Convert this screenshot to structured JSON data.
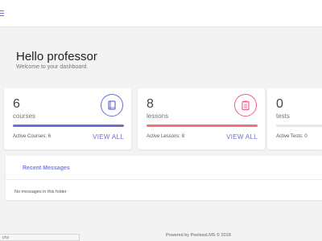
{
  "header": {
    "menu_icon": "hamburger-menu-icon"
  },
  "greeting": {
    "title": "Hello professor",
    "subtitle": "Welcome to your dashboard."
  },
  "cards": {
    "courses": {
      "count": "6",
      "label": "courses",
      "active": "Active Courses: 6",
      "link": "VIEW ALL",
      "color": "#6b6fd4",
      "icon": "book-icon"
    },
    "lessons": {
      "count": "8",
      "label": "lessons",
      "active": "Active Lessons: 8",
      "link": "VIEW ALL",
      "color": "#ef7474",
      "icon": "clipboard-icon"
    },
    "tests": {
      "count": "0",
      "label": "tests",
      "active": "Active Tests: 0"
    }
  },
  "messages": {
    "title": "Recent Messages",
    "empty": "No messages in this folder"
  },
  "footer": {
    "text": "Powered by PeelessLMS © 2018"
  },
  "status_bar": {
    "url": "php"
  }
}
